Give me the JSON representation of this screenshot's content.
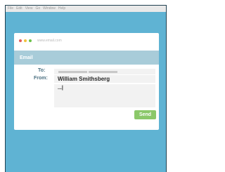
{
  "menubar": {
    "items": [
      "File",
      "Edit",
      "View",
      "Go",
      "Window",
      "Help"
    ]
  },
  "window": {
    "url": "www.email.com",
    "header_title": "Email"
  },
  "form": {
    "to_label": "To:",
    "from_label": "From:",
    "from_value": "William Smithsberg",
    "body_value": "...|"
  },
  "actions": {
    "send_label": "Send"
  },
  "colors": {
    "background": "#5fb3d3",
    "header": "#a8ccd9",
    "send_button": "#8bc86a",
    "label": "#4a6f80"
  }
}
